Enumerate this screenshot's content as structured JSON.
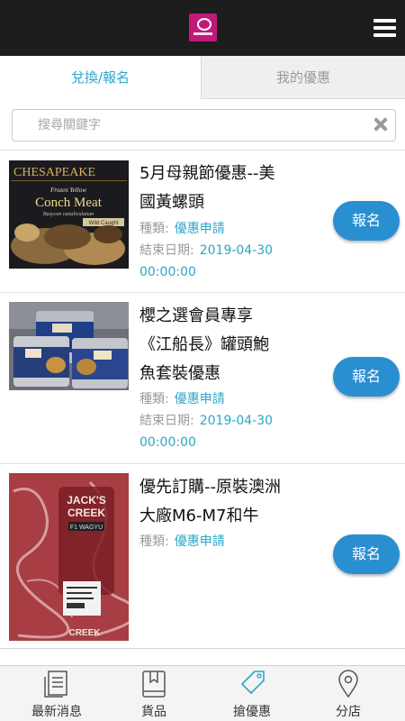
{
  "header": {
    "logo_alt": "logo",
    "menu_icon": "hamburger-menu-icon"
  },
  "tabs": [
    {
      "label": "兌換/報名",
      "active": true
    },
    {
      "label": "我的優惠",
      "active": false
    }
  ],
  "search": {
    "placeholder": "搜尋關鍵字",
    "value": ""
  },
  "offers": [
    {
      "title_line1": "5月母親節優惠--美",
      "title_line2": "國黃螺頭",
      "type_label": "種類:",
      "type_value": "優惠申請",
      "end_label": "結束日期:",
      "end_date": "2019-04-30",
      "end_time": "00:00:00",
      "button": "報名",
      "image_text": {
        "brand": "CHESAPEAKE",
        "line1": "Frozen Yellow",
        "line2": "Conch Meat",
        "line3": "Busycon canaliculatum",
        "line4": "Wild Caught"
      }
    },
    {
      "title_line1": "櫻之選會員專享",
      "title_line2": "《江船長》罐頭鮑",
      "title_line3": "魚套裝優惠",
      "type_label": "種類:",
      "type_value": "優惠申請",
      "end_label": "結束日期:",
      "end_date": "2019-04-30",
      "end_time": "00:00:00",
      "button": "報名"
    },
    {
      "title_line1": "優先訂購--原裝澳洲",
      "title_line2": "大廠M6-M7和牛",
      "type_label": "種類:",
      "type_value": "優惠申請",
      "button": "報名",
      "image_text": {
        "brand_a": "JACK'S",
        "brand_b": "CREEK",
        "badge": "F1 WAGYU",
        "bottom": "CREEK"
      }
    }
  ],
  "bottom_nav": [
    {
      "label": "最新消息",
      "icon": "news-icon"
    },
    {
      "label": "貨品",
      "icon": "book-icon"
    },
    {
      "label": "搶優惠",
      "icon": "tag-icon",
      "active": true
    },
    {
      "label": "分店",
      "icon": "location-pin-icon"
    }
  ],
  "colors": {
    "accent": "#2ba6c9",
    "button": "#2a8fd1",
    "topbar": "#1d1d1d",
    "logo": "#c2187a"
  }
}
